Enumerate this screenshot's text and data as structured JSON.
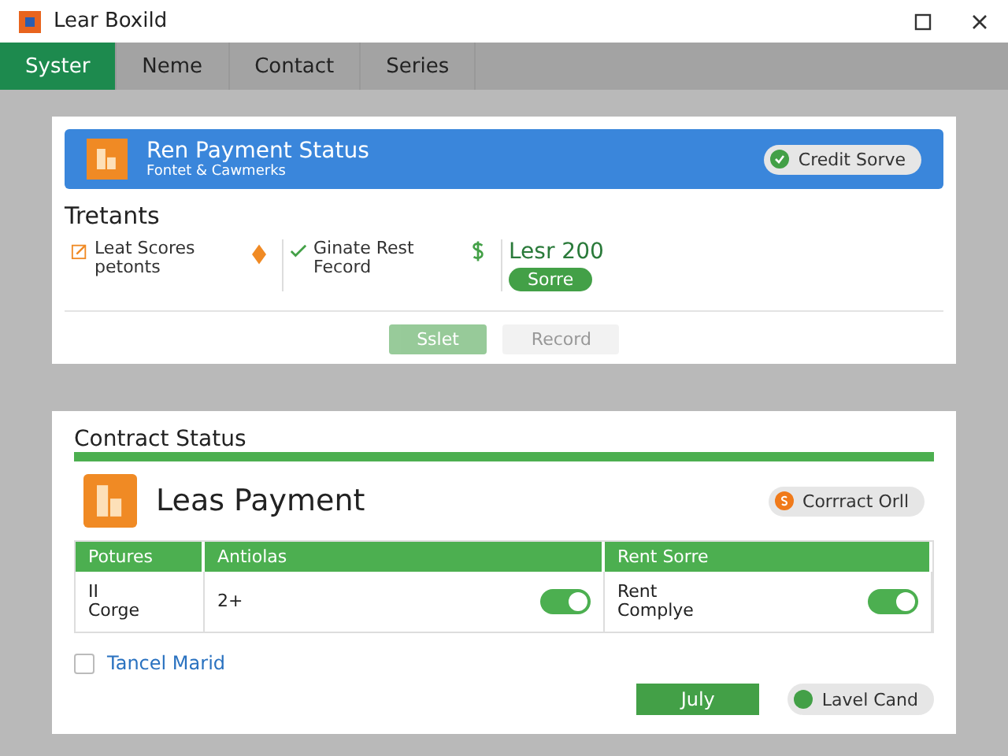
{
  "window": {
    "title": "Lear Boxild"
  },
  "tabs": [
    {
      "label": "Syster",
      "selected": true
    },
    {
      "label": "Neme",
      "selected": false
    },
    {
      "label": "Contact",
      "selected": false
    },
    {
      "label": "Series",
      "selected": false
    }
  ],
  "header": {
    "title": "Ren Payment Status",
    "subtitle": "Fontet & Cawmerks",
    "badge": "Credit Sorve"
  },
  "tenants": {
    "title": "Tretants",
    "items": [
      {
        "kind": "edit",
        "text": "Leat Scores\npetonts"
      },
      {
        "kind": "check",
        "text": "Ginate Rest\nFecord"
      },
      {
        "kind": "amount",
        "text": "Lesr 200",
        "tag": "Sorre"
      }
    ]
  },
  "actions": [
    {
      "label": "Sslet",
      "disabled": true
    },
    {
      "label": "Record",
      "disabled": true
    }
  ],
  "contract": {
    "title": "Contract Status",
    "name": "Leas Payment",
    "badge": "Corrract Orll",
    "columns": [
      "Potures",
      "Antiolas",
      "Rent Sorre"
    ],
    "row": [
      {
        "text": "II\nCorge"
      },
      {
        "text": "2+",
        "on": true
      },
      {
        "text": "Rent\nComplye",
        "on": true
      }
    ],
    "checkbox": {
      "label": "Tancel Marid",
      "checked": false
    },
    "buttons": [
      {
        "kind": "primary",
        "label": "July"
      },
      {
        "kind": "pill",
        "label": "Lavel Cand"
      }
    ]
  }
}
